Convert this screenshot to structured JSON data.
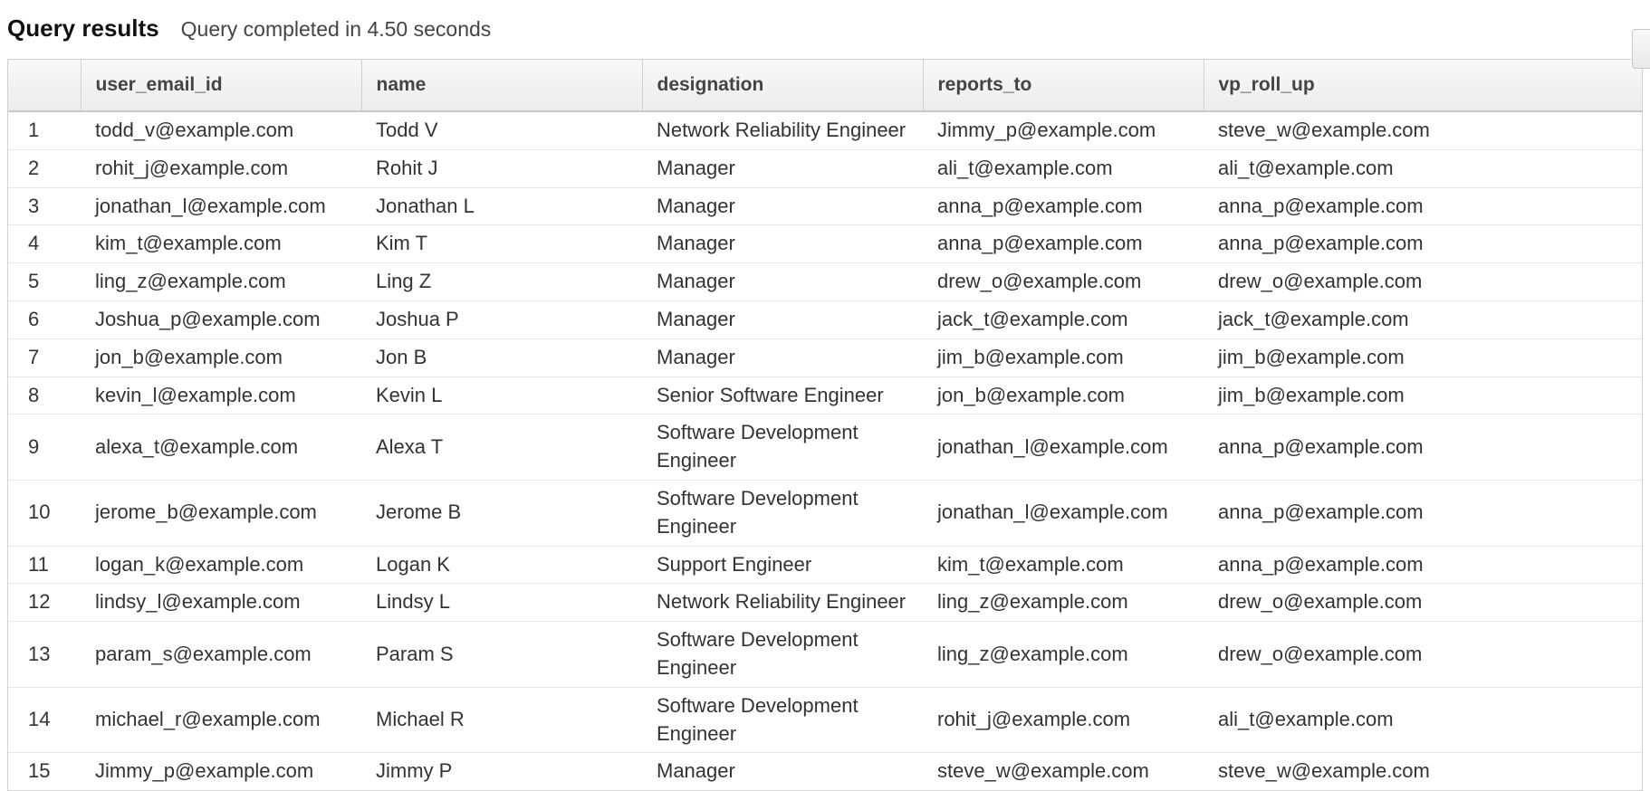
{
  "header": {
    "title": "Query results",
    "subtitle": "Query completed in 4.50 seconds"
  },
  "table": {
    "columns": [
      "",
      "user_email_id",
      "name",
      "designation",
      "reports_to",
      "vp_roll_up"
    ],
    "rows": [
      {
        "n": "1",
        "user_email_id": "todd_v@example.com",
        "name": "Todd V",
        "designation": "Network Reliability Engineer",
        "reports_to": "Jimmy_p@example.com",
        "vp_roll_up": "steve_w@example.com"
      },
      {
        "n": "2",
        "user_email_id": "rohit_j@example.com",
        "name": "Rohit J",
        "designation": "Manager",
        "reports_to": "ali_t@example.com",
        "vp_roll_up": "ali_t@example.com"
      },
      {
        "n": "3",
        "user_email_id": "jonathan_l@example.com",
        "name": "Jonathan L",
        "designation": "Manager",
        "reports_to": "anna_p@example.com",
        "vp_roll_up": "anna_p@example.com"
      },
      {
        "n": "4",
        "user_email_id": "kim_t@example.com",
        "name": "Kim T",
        "designation": "Manager",
        "reports_to": "anna_p@example.com",
        "vp_roll_up": "anna_p@example.com"
      },
      {
        "n": "5",
        "user_email_id": "ling_z@example.com",
        "name": "Ling Z",
        "designation": "Manager",
        "reports_to": "drew_o@example.com",
        "vp_roll_up": "drew_o@example.com"
      },
      {
        "n": "6",
        "user_email_id": "Joshua_p@example.com",
        "name": "Joshua P",
        "designation": "Manager",
        "reports_to": "jack_t@example.com",
        "vp_roll_up": "jack_t@example.com"
      },
      {
        "n": "7",
        "user_email_id": "jon_b@example.com",
        "name": "Jon B",
        "designation": "Manager",
        "reports_to": "jim_b@example.com",
        "vp_roll_up": "jim_b@example.com"
      },
      {
        "n": "8",
        "user_email_id": "kevin_l@example.com",
        "name": "Kevin L",
        "designation": "Senior Software Engineer",
        "reports_to": "jon_b@example.com",
        "vp_roll_up": "jim_b@example.com"
      },
      {
        "n": "9",
        "user_email_id": "alexa_t@example.com",
        "name": "Alexa T",
        "designation": "Software Development Engineer",
        "reports_to": "jonathan_l@example.com",
        "vp_roll_up": "anna_p@example.com"
      },
      {
        "n": "10",
        "user_email_id": "jerome_b@example.com",
        "name": "Jerome B",
        "designation": "Software Development Engineer",
        "reports_to": "jonathan_l@example.com",
        "vp_roll_up": "anna_p@example.com"
      },
      {
        "n": "11",
        "user_email_id": "logan_k@example.com",
        "name": "Logan K",
        "designation": "Support Engineer",
        "reports_to": "kim_t@example.com",
        "vp_roll_up": "anna_p@example.com"
      },
      {
        "n": "12",
        "user_email_id": "lindsy_l@example.com",
        "name": "Lindsy L",
        "designation": "Network Reliability Engineer",
        "reports_to": "ling_z@example.com",
        "vp_roll_up": "drew_o@example.com"
      },
      {
        "n": "13",
        "user_email_id": "param_s@example.com",
        "name": "Param S",
        "designation": "Software Development Engineer",
        "reports_to": "ling_z@example.com",
        "vp_roll_up": "drew_o@example.com"
      },
      {
        "n": "14",
        "user_email_id": "michael_r@example.com",
        "name": "Michael R",
        "designation": "Software Development Engineer",
        "reports_to": "rohit_j@example.com",
        "vp_roll_up": "ali_t@example.com"
      },
      {
        "n": "15",
        "user_email_id": "Jimmy_p@example.com",
        "name": "Jimmy P",
        "designation": "Manager",
        "reports_to": "steve_w@example.com",
        "vp_roll_up": "steve_w@example.com"
      }
    ]
  }
}
